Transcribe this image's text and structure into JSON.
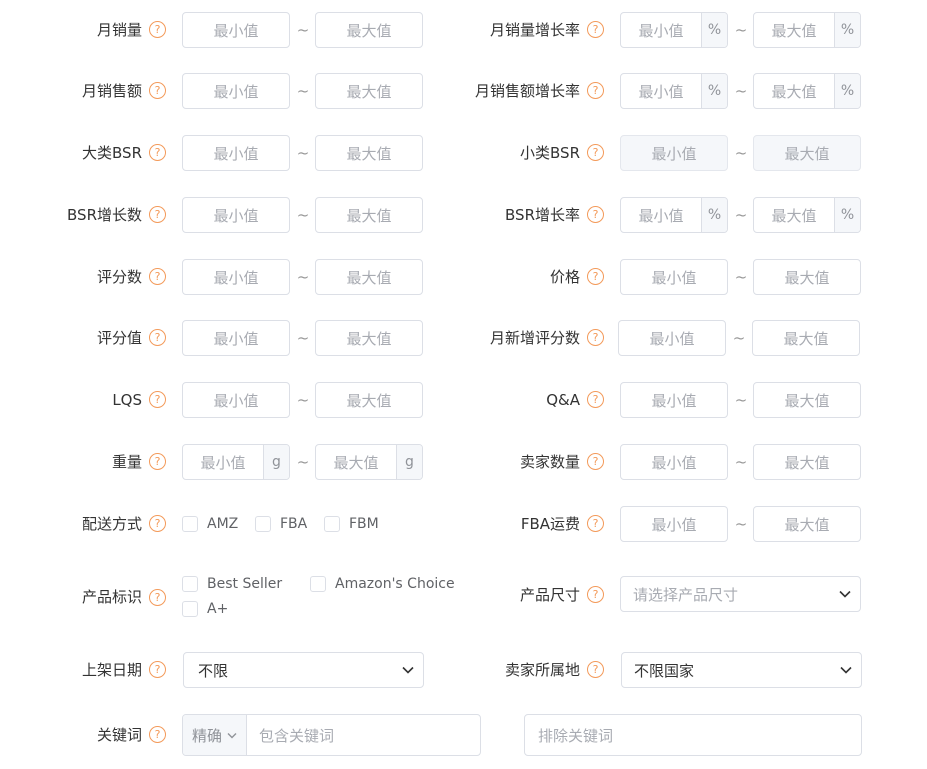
{
  "placeholders": {
    "min": "最小值",
    "max": "最大值",
    "tilde": "~",
    "percent": "%",
    "gram": "g",
    "help": "?"
  },
  "left": {
    "monthly_sales": "月销量",
    "monthly_revenue": "月销售额",
    "main_bsr": "大类BSR",
    "bsr_growth_count": "BSR增长数",
    "rating_count": "评分数",
    "rating_value": "评分值",
    "lqs": "LQS",
    "weight": "重量",
    "shipping_method": "配送方式",
    "product_badge": "产品标识",
    "listing_date": "上架日期",
    "keywords": "关键词"
  },
  "right": {
    "monthly_sales_growth": "月销量增长率",
    "monthly_revenue_growth": "月销售额增长率",
    "sub_bsr": "小类BSR",
    "bsr_growth_rate": "BSR增长率",
    "price": "价格",
    "monthly_new_ratings": "月新增评分数",
    "qa": "Q&A",
    "seller_count": "卖家数量",
    "fba_fee": "FBA运费",
    "product_size": "产品尺寸",
    "seller_location": "卖家所属地"
  },
  "shipping_options": [
    "AMZ",
    "FBA",
    "FBM"
  ],
  "badge_options": [
    "Best Seller",
    "Amazon's Choice",
    "A+"
  ],
  "selects": {
    "product_size_placeholder": "请选择产品尺寸",
    "listing_date_value": "不限",
    "seller_location_value": "不限国家"
  },
  "keywords": {
    "match_mode": "精确",
    "include_placeholder": "包含关键词",
    "exclude_placeholder": "排除关键词"
  },
  "colors": {
    "help_icon": "#f39a5a",
    "border": "#dcdfe6",
    "placeholder": "#a8abb2"
  }
}
